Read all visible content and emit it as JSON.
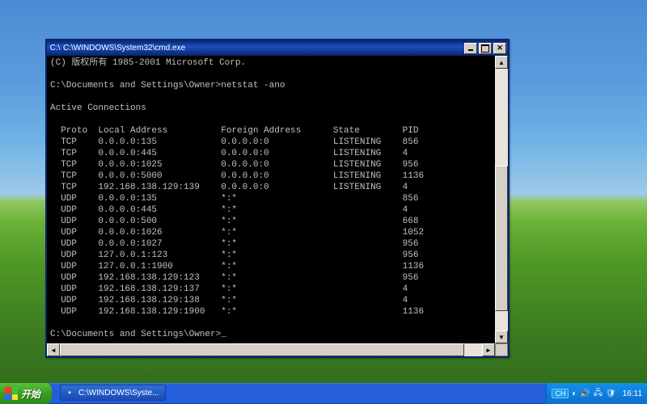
{
  "window": {
    "title": "C:\\WINDOWS\\System32\\cmd.exe",
    "icon_glyph": "C:\\"
  },
  "console": {
    "copyright": "(C) 版权所有 1985-2001 Microsoft Corp.",
    "prompt1": "C:\\Documents and Settings\\Owner>",
    "command1": "netstat -ano",
    "section": "Active Connections",
    "headers": {
      "proto": "Proto",
      "local": "Local Address",
      "foreign": "Foreign Address",
      "state": "State",
      "pid": "PID"
    },
    "rows": [
      {
        "proto": "TCP",
        "local": "0.0.0.0:135",
        "foreign": "0.0.0.0:0",
        "state": "LISTENING",
        "pid": "856"
      },
      {
        "proto": "TCP",
        "local": "0.0.0.0:445",
        "foreign": "0.0.0.0:0",
        "state": "LISTENING",
        "pid": "4"
      },
      {
        "proto": "TCP",
        "local": "0.0.0.0:1025",
        "foreign": "0.0.0.0:0",
        "state": "LISTENING",
        "pid": "956"
      },
      {
        "proto": "TCP",
        "local": "0.0.0.0:5000",
        "foreign": "0.0.0.0:0",
        "state": "LISTENING",
        "pid": "1136"
      },
      {
        "proto": "TCP",
        "local": "192.168.138.129:139",
        "foreign": "0.0.0.0:0",
        "state": "LISTENING",
        "pid": "4"
      },
      {
        "proto": "UDP",
        "local": "0.0.0.0:135",
        "foreign": "*:*",
        "state": "",
        "pid": "856"
      },
      {
        "proto": "UDP",
        "local": "0.0.0.0:445",
        "foreign": "*:*",
        "state": "",
        "pid": "4"
      },
      {
        "proto": "UDP",
        "local": "0.0.0.0:500",
        "foreign": "*:*",
        "state": "",
        "pid": "668"
      },
      {
        "proto": "UDP",
        "local": "0.0.0.0:1026",
        "foreign": "*:*",
        "state": "",
        "pid": "1052"
      },
      {
        "proto": "UDP",
        "local": "0.0.0.0:1027",
        "foreign": "*:*",
        "state": "",
        "pid": "956"
      },
      {
        "proto": "UDP",
        "local": "127.0.0.1:123",
        "foreign": "*:*",
        "state": "",
        "pid": "956"
      },
      {
        "proto": "UDP",
        "local": "127.0.0.1:1900",
        "foreign": "*:*",
        "state": "",
        "pid": "1136"
      },
      {
        "proto": "UDP",
        "local": "192.168.138.129:123",
        "foreign": "*:*",
        "state": "",
        "pid": "956"
      },
      {
        "proto": "UDP",
        "local": "192.168.138.129:137",
        "foreign": "*:*",
        "state": "",
        "pid": "4"
      },
      {
        "proto": "UDP",
        "local": "192.168.138.129:138",
        "foreign": "*:*",
        "state": "",
        "pid": "4"
      },
      {
        "proto": "UDP",
        "local": "192.168.138.129:1900",
        "foreign": "*:*",
        "state": "",
        "pid": "1136"
      }
    ],
    "prompt2": "C:\\Documents and Settings\\Owner>",
    "cursor": "_"
  },
  "taskbar": {
    "start_label": "开始",
    "task_label": "C:\\WINDOWS\\Syste...",
    "lang": "CH",
    "clock": "16:11"
  }
}
